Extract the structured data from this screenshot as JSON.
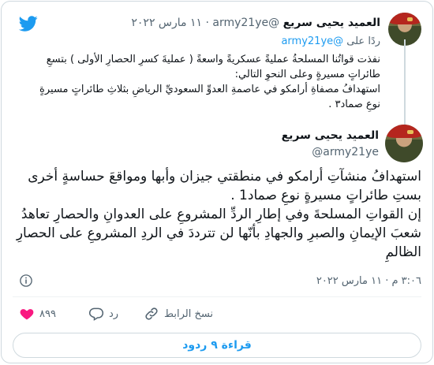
{
  "brand": {
    "color": "#1d9bf0",
    "icon": "twitter-bird-icon"
  },
  "quoted": {
    "author_name": "العميد يحيى سريع",
    "handle": "@army21ye",
    "separator": " · ",
    "date": "١١ مارس ٢٠٢٢",
    "reply_prefix": "ردًا على ",
    "reply_to": "@army21ye",
    "text": "نفذت قواتُنا المسلحةُ عمليةً عسكريةً واسعةً   ( عمليةَ كسرِ الحصارِ الأولى )  بتسعِ طائراتٍ مسيرةٍ وعلى النحوِ التالي:\nاستهدافُ مصفاةِ أرامكو في عاصمةِ العدوِّ السعوديِّ الرياضِ بثلاثِ طائراتٍ مسيرةٍ نوعِ صماد٣ ."
  },
  "tweet": {
    "author_name": "العميد يحيى سريع",
    "handle": "@army21ye",
    "text": "استهدافُ منشآتِ أرامكو في منطقتي جيزان وأبها ومواقعَ حساسةٍ أخرى بستِ طائراتٍ مسيرةٍ نوعِ صماد1 .\nإن القواتِ المسلحةَ وفي إطارِ الردِّ المشروعِ على العدوانِ والحصارِ تعاهدُ شعبَ الإيمانِ والصبرِ والجهادِ بأنّها لن تترددَ في الردِ المشروعِ على الحصارِ الظالمِ",
    "timestamp": "٣:٠٦ م · ١١ مارس ٢٠٢٢"
  },
  "actions": {
    "likes_count": "٨٩٩",
    "reply_label": "رد",
    "copy_link_label": "نسخ الرابط"
  },
  "read_replies_label": "قراءة ٩ ردود"
}
